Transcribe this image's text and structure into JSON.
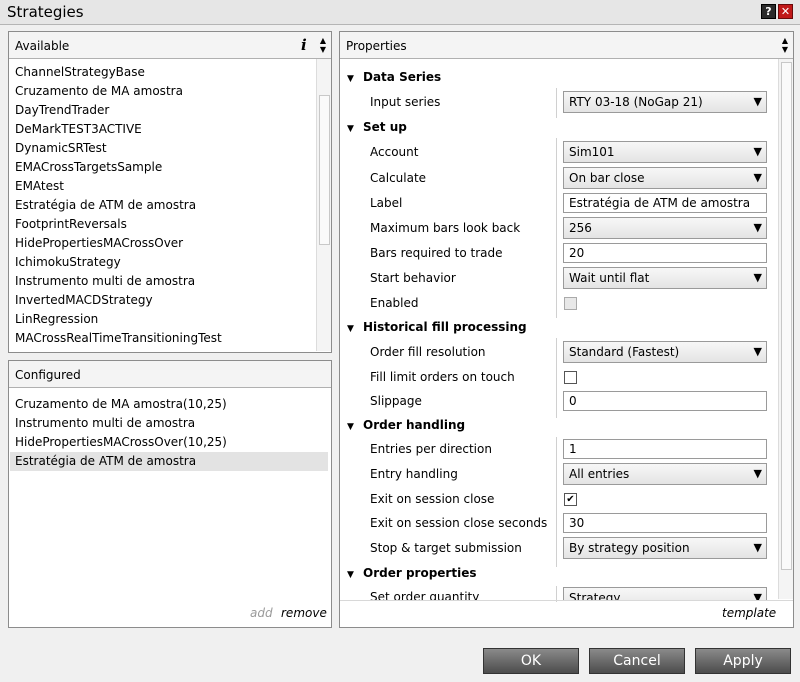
{
  "window": {
    "title": "Strategies"
  },
  "available": {
    "header": "Available",
    "info_icon": "i",
    "items": [
      "ChannelStrategyBase",
      "Cruzamento de MA amostra",
      "DayTrendTrader",
      "DeMarkTEST3ACTIVE",
      "DynamicSRTest",
      "EMACrossTargetsSample",
      "EMAtest",
      "Estratégia de ATM de amostra",
      "FootprintReversals",
      "HidePropertiesMACrossOver",
      "IchimokuStrategy",
      "Instrumento multi de amostra",
      "InvertedMACDStrategy",
      "LinRegression",
      "MACrossRealTimeTransitioningTest"
    ]
  },
  "configured": {
    "header": "Configured",
    "items": [
      "Cruzamento de MA amostra(10,25)",
      "Instrumento multi de amostra",
      "HidePropertiesMACrossOver(10,25)",
      "Estratégia de ATM de amostra"
    ],
    "selected_index": 3,
    "add_label": "add",
    "remove_label": "remove"
  },
  "properties": {
    "header": "Properties",
    "template_label": "template",
    "sections": {
      "data_series": {
        "title": "Data Series",
        "input_series_label": "Input series",
        "input_series_value": "RTY 03-18 (NoGap 21)"
      },
      "setup": {
        "title": "Set up",
        "account_label": "Account",
        "account_value": "Sim101",
        "calculate_label": "Calculate",
        "calculate_value": "On bar close",
        "label_label": "Label",
        "label_value": "Estratégia de ATM de amostra",
        "max_bars_label": "Maximum bars look back",
        "max_bars_value": "256",
        "bars_required_label": "Bars required to trade",
        "bars_required_value": "20",
        "start_behavior_label": "Start behavior",
        "start_behavior_value": "Wait until flat",
        "enabled_label": "Enabled",
        "enabled_checked": false
      },
      "historical": {
        "title": "Historical fill processing",
        "order_fill_label": "Order fill resolution",
        "order_fill_value": "Standard (Fastest)",
        "fill_limit_label": "Fill limit orders on touch",
        "fill_limit_checked": false,
        "slippage_label": "Slippage",
        "slippage_value": "0"
      },
      "order_handling": {
        "title": "Order handling",
        "entries_label": "Entries per direction",
        "entries_value": "1",
        "entry_handling_label": "Entry handling",
        "entry_handling_value": "All entries",
        "exit_session_label": "Exit on session close",
        "exit_session_checked": true,
        "exit_seconds_label": "Exit on session close seconds",
        "exit_seconds_value": "30",
        "stop_target_label": "Stop & target submission",
        "stop_target_value": "By strategy position"
      },
      "order_properties": {
        "title": "Order properties",
        "set_qty_label": "Set order quantity",
        "set_qty_value": "Strategy"
      }
    }
  },
  "buttons": {
    "ok": "OK",
    "cancel": "Cancel",
    "apply": "Apply"
  }
}
